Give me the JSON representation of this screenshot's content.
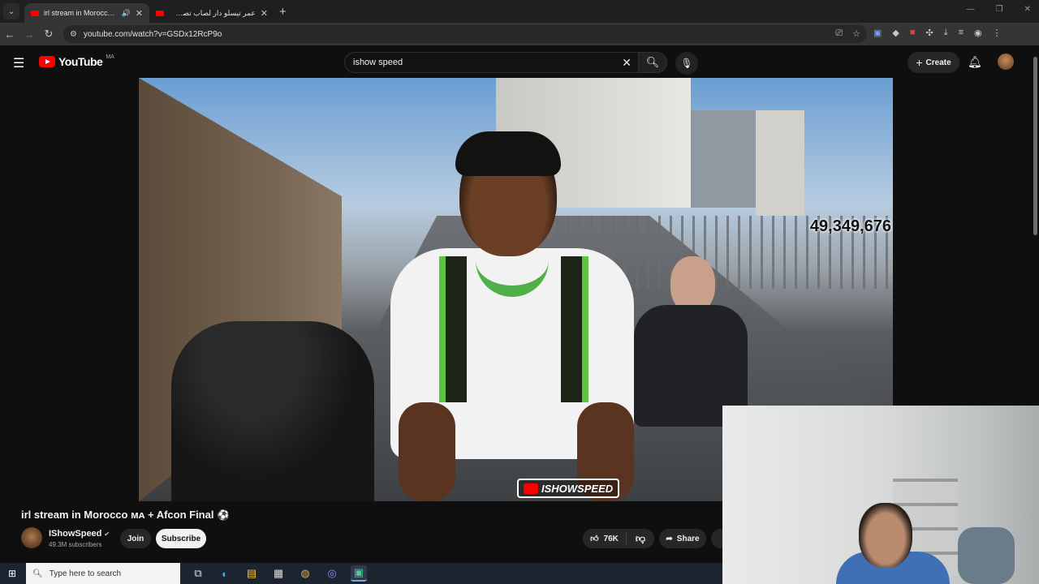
{
  "browser": {
    "tabs": [
      {
        "title": "irl stream in Morocco ᴍᴀ + Afcon Final",
        "active": true,
        "audio": true
      },
      {
        "title": "عمر تيسلو دار لصاب تصب | الريح",
        "active": false
      }
    ],
    "url": "youtube.com/watch?v=GSDx12RcP9o",
    "new_tab": "+",
    "window_controls": [
      "—",
      "❐",
      "✕"
    ]
  },
  "youtube": {
    "logo_text": "YouTube",
    "country_code": "MA",
    "search_query": "ishow speed",
    "create_label": "Create",
    "video": {
      "viewer_count_overlay": "49,349,676",
      "watermark_text": "ISHOWSPEED",
      "title": "irl stream in Morocco ᴍᴀ + Afcon Final",
      "title_icon": "⚽",
      "channel_name": "IShowSpeed",
      "subscribers": "49.3M subscribers",
      "join_label": "Join",
      "subscribe_label": "Subscribe",
      "likes": "76K",
      "share_label": "Share"
    }
  },
  "taskbar": {
    "search_placeholder": "Type here to search"
  },
  "colors": {
    "youtube_red": "#ff0000",
    "background": "#0f0f0f",
    "accent_green": "#4fb04a"
  }
}
